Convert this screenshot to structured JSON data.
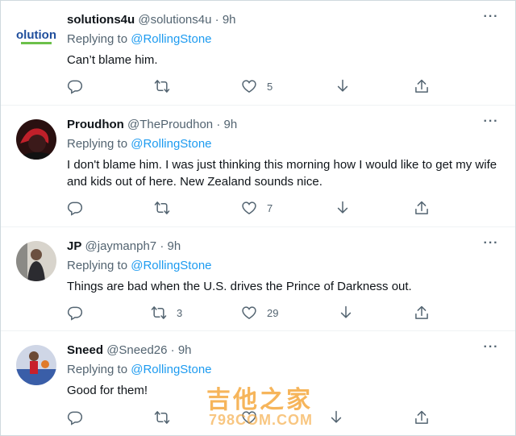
{
  "colors": {
    "accent": "#1d9bf0",
    "secondary_text": "#536471",
    "primary_text": "#0f1419",
    "border": "#eff3f4"
  },
  "tweets": [
    {
      "name": "solutions4u",
      "handle": "@solutions4u",
      "separator": "·",
      "time": "9h",
      "replying_prefix": "Replying to",
      "replying_to": "@RollingStone",
      "text": "Can’t blame him.",
      "reply_count": "",
      "retweet_count": "",
      "like_count": "5",
      "avatar": "solutions-logo"
    },
    {
      "name": "Proudhon",
      "handle": "@TheProudhon",
      "separator": "·",
      "time": "9h",
      "replying_prefix": "Replying to",
      "replying_to": "@RollingStone",
      "text": "I don't blame him. I was just thinking this morning how I would like to get my wife and kids out of here. New Zealand sounds nice.",
      "reply_count": "",
      "retweet_count": "",
      "like_count": "7",
      "avatar": "red-portrait"
    },
    {
      "name": "JP",
      "handle": "@jaymanph7",
      "separator": "·",
      "time": "9h",
      "replying_prefix": "Replying to",
      "replying_to": "@RollingStone",
      "text": "Things are bad when the U.S. drives the Prince of Darkness out.",
      "reply_count": "",
      "retweet_count": "3",
      "like_count": "29",
      "avatar": "person-photo"
    },
    {
      "name": "Sneed",
      "handle": "@Sneed26",
      "separator": "·",
      "time": "9h",
      "replying_prefix": "Replying to",
      "replying_to": "@RollingStone",
      "text": "Good for them!",
      "reply_count": "",
      "retweet_count": "",
      "like_count": "",
      "avatar": "basketball-photo"
    }
  ],
  "watermark": {
    "line1": "吉他之家",
    "line2": "798COM.COM"
  },
  "avatar_logo_text": "solutions"
}
